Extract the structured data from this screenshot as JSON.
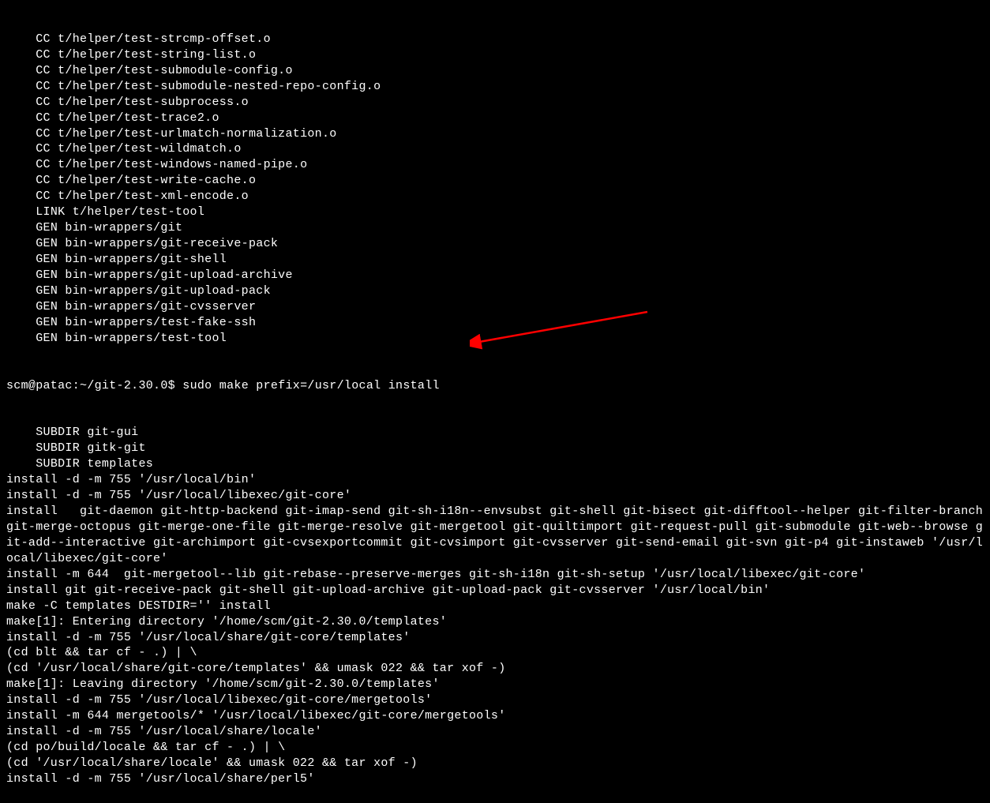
{
  "lines_before_prompt": [
    "    CC t/helper/test-strcmp-offset.o",
    "    CC t/helper/test-string-list.o",
    "    CC t/helper/test-submodule-config.o",
    "    CC t/helper/test-submodule-nested-repo-config.o",
    "    CC t/helper/test-subprocess.o",
    "    CC t/helper/test-trace2.o",
    "    CC t/helper/test-urlmatch-normalization.o",
    "    CC t/helper/test-wildmatch.o",
    "    CC t/helper/test-windows-named-pipe.o",
    "    CC t/helper/test-write-cache.o",
    "    CC t/helper/test-xml-encode.o",
    "    LINK t/helper/test-tool",
    "    GEN bin-wrappers/git",
    "    GEN bin-wrappers/git-receive-pack",
    "    GEN bin-wrappers/git-shell",
    "    GEN bin-wrappers/git-upload-archive",
    "    GEN bin-wrappers/git-upload-pack",
    "    GEN bin-wrappers/git-cvsserver",
    "    GEN bin-wrappers/test-fake-ssh",
    "    GEN bin-wrappers/test-tool"
  ],
  "prompt": {
    "user_host": "scm@patac",
    "path": "~/git-2.30.0",
    "symbol": "$",
    "command": "sudo make prefix=/usr/local install"
  },
  "lines_after_prompt": [
    "    SUBDIR git-gui",
    "    SUBDIR gitk-git",
    "    SUBDIR templates",
    "install -d -m 755 '/usr/local/bin'",
    "install -d -m 755 '/usr/local/libexec/git-core'",
    "install   git-daemon git-http-backend git-imap-send git-sh-i18n--envsubst git-shell git-bisect git-difftool--helper git-filter-branch git-merge-octopus git-merge-one-file git-merge-resolve git-mergetool git-quiltimport git-request-pull git-submodule git-web--browse git-add--interactive git-archimport git-cvsexportcommit git-cvsimport git-cvsserver git-send-email git-svn git-p4 git-instaweb '/usr/local/libexec/git-core'",
    "install -m 644  git-mergetool--lib git-rebase--preserve-merges git-sh-i18n git-sh-setup '/usr/local/libexec/git-core'",
    "install git git-receive-pack git-shell git-upload-archive git-upload-pack git-cvsserver '/usr/local/bin'",
    "make -C templates DESTDIR='' install",
    "make[1]: Entering directory '/home/scm/git-2.30.0/templates'",
    "install -d -m 755 '/usr/local/share/git-core/templates'",
    "(cd blt && tar cf - .) | \\",
    "(cd '/usr/local/share/git-core/templates' && umask 022 && tar xof -)",
    "make[1]: Leaving directory '/home/scm/git-2.30.0/templates'",
    "install -d -m 755 '/usr/local/libexec/git-core/mergetools'",
    "install -m 644 mergetools/* '/usr/local/libexec/git-core/mergetools'",
    "install -d -m 755 '/usr/local/share/locale'",
    "(cd po/build/locale && tar cf - .) | \\",
    "(cd '/usr/local/share/locale' && umask 022 && tar xof -)",
    "install -d -m 755 '/usr/local/share/perl5'"
  ],
  "annotation": {
    "type": "arrow",
    "color": "#ff0000"
  }
}
